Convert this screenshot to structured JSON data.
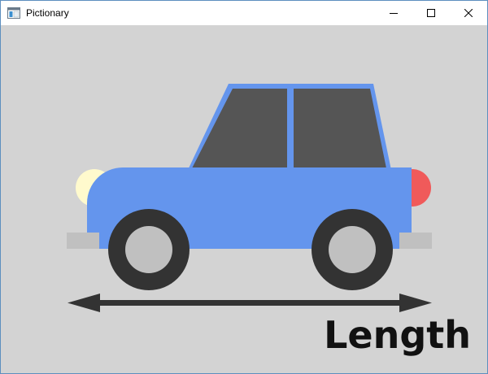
{
  "window": {
    "title": "Pictionary"
  },
  "icons": {
    "app": "app-window-icon",
    "minimize": "minimize-icon",
    "maximize": "maximize-icon",
    "close": "close-icon"
  },
  "drawing": {
    "subject": "car",
    "label": "Length",
    "arrow": "double-headed-arrow",
    "colors": {
      "background": "#d3d3d3",
      "body": "#6495ed",
      "window_glass": "#555555",
      "tire": "#333333",
      "hubcap": "#c0c0c0",
      "headlight": "#fffacd",
      "taillight": "#f05a5a",
      "bumper": "#c0c0c0",
      "arrow": "#333333"
    }
  }
}
